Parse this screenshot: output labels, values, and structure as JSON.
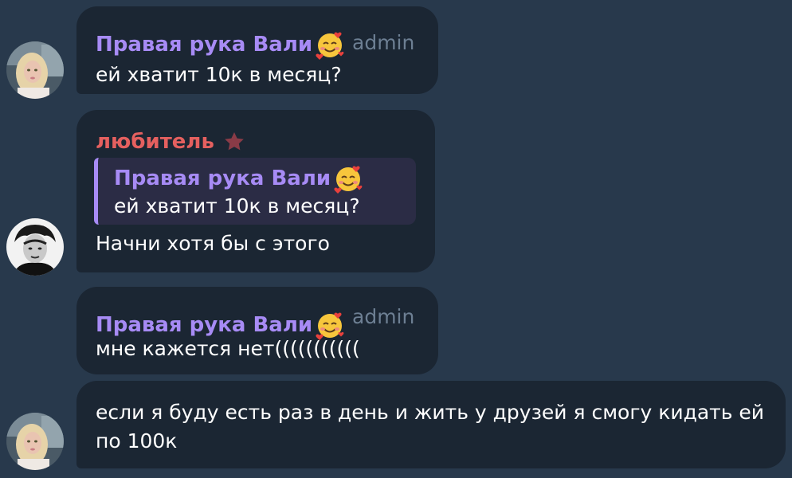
{
  "messages": [
    {
      "sender": "Правая рука Вали",
      "sender_emoji": "smiling-face-with-hearts",
      "role": "admin",
      "text": "ей хватит 10к в месяц?"
    },
    {
      "sender": "любитель",
      "sender_badge": "star-icon",
      "reply": {
        "sender": "Правая рука Вали",
        "sender_emoji": "smiling-face-with-hearts",
        "text": "ей хватит 10к в месяц?"
      },
      "text": "Начни хотя бы с этого"
    },
    {
      "sender": "Правая рука Вали",
      "sender_emoji": "smiling-face-with-hearts",
      "role": "admin",
      "text": "мне кажется нет((((((((((("
    },
    {
      "text_line1": "если я буду есть раз в день и жить у друзей я смогу кидать ей",
      "text_line2": "по 100к"
    }
  ],
  "colors": {
    "background": "#28394c",
    "bubble": "#1b2633",
    "admin_name": "#a78bf5",
    "lover_name": "#e5605f",
    "role": "#6d7f93",
    "quote_bg": "#2b2c45"
  }
}
